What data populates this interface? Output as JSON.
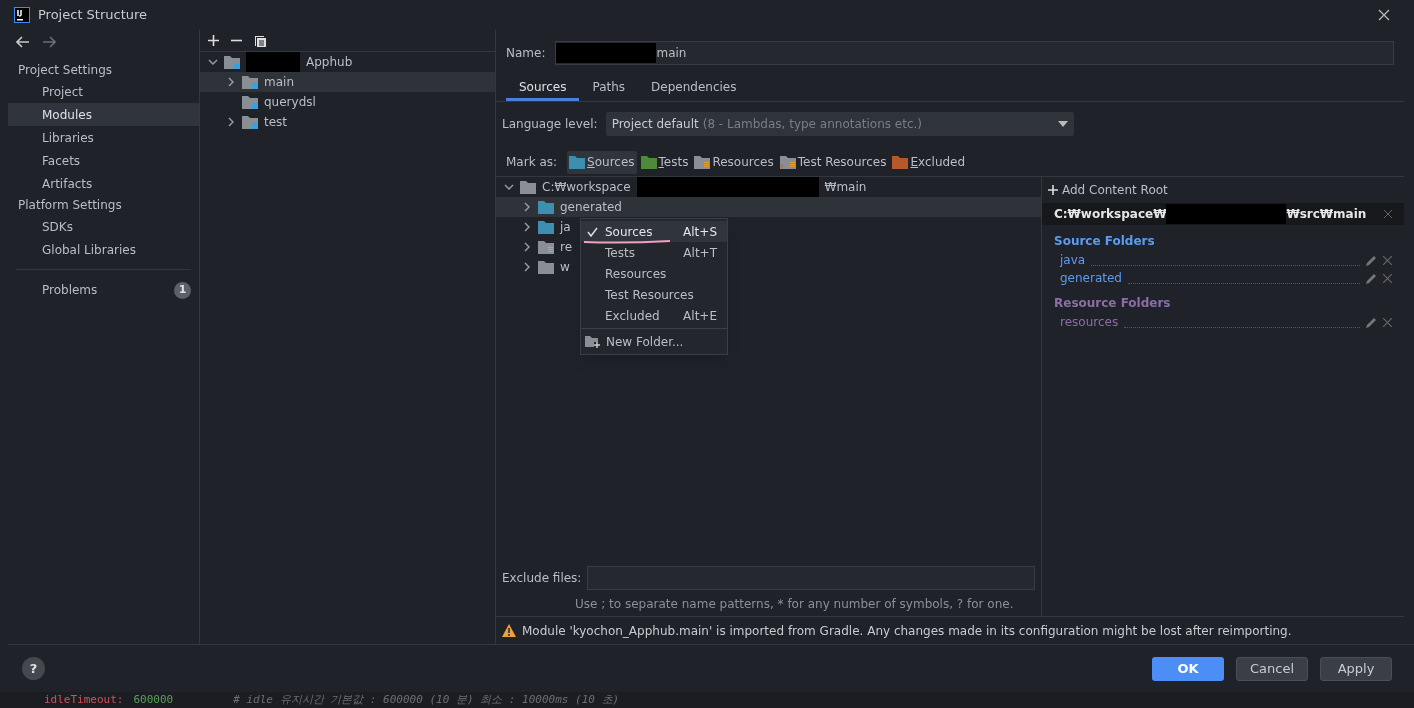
{
  "window": {
    "title": "Project Structure"
  },
  "sidebar": {
    "sections": [
      {
        "heading": "Project Settings",
        "items": [
          {
            "label": "Project",
            "selected": false
          },
          {
            "label": "Modules",
            "selected": true
          },
          {
            "label": "Libraries",
            "selected": false
          },
          {
            "label": "Facets",
            "selected": false
          },
          {
            "label": "Artifacts",
            "selected": false
          }
        ]
      },
      {
        "heading": "Platform Settings",
        "items": [
          {
            "label": "SDKs",
            "selected": false
          },
          {
            "label": "Global Libraries",
            "selected": false
          }
        ]
      }
    ],
    "problems": {
      "label": "Problems",
      "count": "1"
    }
  },
  "module_tree": {
    "label": "Apphub",
    "expanded": true,
    "children": [
      {
        "label": "main",
        "expandable": true,
        "selected": true
      },
      {
        "label": "querydsl",
        "expandable": false,
        "selected": false
      },
      {
        "label": "test",
        "expandable": true,
        "selected": false
      }
    ]
  },
  "name_field": {
    "label": "Name:",
    "value": "main"
  },
  "tabs": [
    {
      "label": "Sources",
      "selected": true
    },
    {
      "label": "Paths",
      "selected": false
    },
    {
      "label": "Dependencies",
      "selected": false
    }
  ],
  "language_level": {
    "label": "Language level:",
    "value": "Project default",
    "hint": "(8 - Lambdas, type annotations etc.)"
  },
  "mark_as": {
    "label": "Mark as:",
    "options": [
      {
        "label": "Sources",
        "kind": "sources",
        "selected": true,
        "underline_first": true
      },
      {
        "label": "Tests",
        "kind": "tests",
        "selected": false,
        "underline_first": true
      },
      {
        "label": "Resources",
        "kind": "resources",
        "selected": false,
        "underline_first": false
      },
      {
        "label": "Test Resources",
        "kind": "test_resources",
        "selected": false,
        "underline_first": false
      },
      {
        "label": "Excluded",
        "kind": "excluded",
        "selected": false,
        "underline_first": true
      }
    ]
  },
  "folder_tree": {
    "path_start": "C:₩workspace",
    "path_end": "₩main",
    "children": [
      {
        "label": "generated",
        "kind": "sources",
        "selected": true
      },
      {
        "label": "ja",
        "kind": "sources",
        "selected": false
      },
      {
        "label": "re",
        "kind": "resources",
        "selected": false
      },
      {
        "label": "w",
        "kind": "plain",
        "selected": false
      }
    ]
  },
  "context_menu": {
    "items": [
      {
        "label": "Sources",
        "shortcut": "Alt+S",
        "checked": true,
        "kind": "option"
      },
      {
        "label": "Tests",
        "shortcut": "Alt+T",
        "checked": false,
        "kind": "option"
      },
      {
        "label": "Resources",
        "checked": false,
        "kind": "option"
      },
      {
        "label": "Test Resources",
        "checked": false,
        "kind": "option"
      },
      {
        "label": "Excluded",
        "shortcut": "Alt+E",
        "checked": false,
        "kind": "option"
      },
      {
        "label": "New Folder...",
        "kind": "action"
      }
    ]
  },
  "content_root": {
    "add_label": "Add Content Root",
    "path_start": "C:₩workspace₩",
    "path_end": "₩src₩main",
    "groups": [
      {
        "heading": "Source Folders",
        "kind": "sources",
        "items": [
          "java",
          "generated"
        ]
      },
      {
        "heading": "Resource Folders",
        "kind": "resources",
        "items": [
          "resources"
        ]
      }
    ]
  },
  "exclude_files": {
    "label": "Exclude files:",
    "hint": "Use ; to separate name patterns, * for any number of symbols, ? for one."
  },
  "warning": "Module 'kyochon_Apphub.main' is imported from Gradle. Any changes made in its configuration might be lost after reimporting.",
  "help": "?",
  "buttons": [
    {
      "label": "OK",
      "primary": true
    },
    {
      "label": "Cancel",
      "primary": false
    },
    {
      "label": "Apply",
      "primary": false
    }
  ],
  "editor_line": {
    "key": "idleTimeout:",
    "value": "600000",
    "comment": "# idle 유지시간 기본값 : 600000 (10 분) 최소 : 10000ms (10 초)"
  }
}
